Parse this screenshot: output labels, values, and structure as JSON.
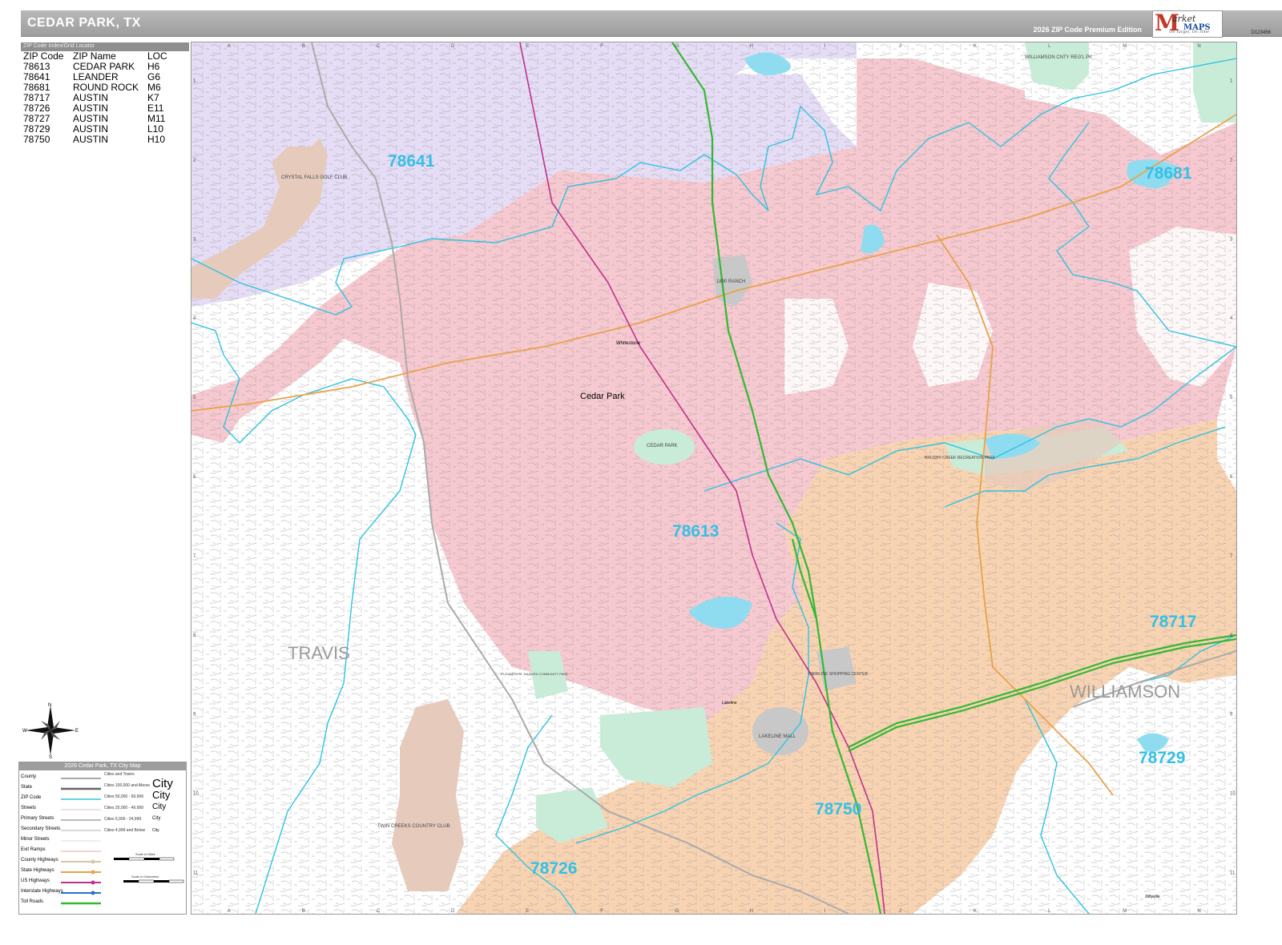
{
  "header": {
    "title": "CEDAR PARK, TX",
    "edition": "2026 ZIP Code Premium Edition",
    "logo": {
      "brand_top": "arket",
      "brand_bottom": "MAPS",
      "tagline": "On Target, On Time"
    },
    "sku": "D123456"
  },
  "zip_index": {
    "heading": "ZIP Code Index/Grid Locator",
    "columns": [
      "ZIP Code",
      "ZIP Name",
      "LOC"
    ],
    "rows": [
      [
        "78613",
        "CEDAR PARK",
        "H6"
      ],
      [
        "78641",
        "LEANDER",
        "G6"
      ],
      [
        "78681",
        "ROUND ROCK",
        "M6"
      ],
      [
        "78717",
        "AUSTIN",
        "K7"
      ],
      [
        "78726",
        "AUSTIN",
        "E11"
      ],
      [
        "78727",
        "AUSTIN",
        "M11"
      ],
      [
        "78729",
        "AUSTIN",
        "L10"
      ],
      [
        "78750",
        "AUSTIN",
        "H10"
      ]
    ]
  },
  "map": {
    "colors": {
      "cedar_park": "#f6c8cf",
      "leander": "#e5dcf5",
      "austin": "#f8d3b2",
      "park": "#c9ecd9",
      "golf": "#e6cbbd",
      "water": "#8fdcf0",
      "zip_boundary": "#2ec3e0",
      "interstate": "#33b833",
      "us_highway": "#c0308c",
      "state_highway": "#e8a24a"
    },
    "column_letters": [
      "A",
      "B",
      "C",
      "D",
      "E",
      "F",
      "G",
      "H",
      "I",
      "J",
      "K",
      "L",
      "M",
      "N"
    ],
    "row_numbers": [
      "1",
      "2",
      "3",
      "4",
      "5",
      "6",
      "7",
      "8",
      "9",
      "10",
      "11"
    ],
    "zip_labels": [
      "78641",
      "78681",
      "78613",
      "78717",
      "78729",
      "78750",
      "78726"
    ],
    "county_labels": [
      "TRAVIS",
      "WILLIAMSON"
    ],
    "city_label": "Cedar Park",
    "place_labels": [
      "CRYSTAL FALLS GOLF CLUB",
      "1890 RANCH",
      "CEDAR PARK",
      "WILLIAMSON CNTY REG'L PK",
      "BRUSHY CREEK RECREATION PARK",
      "PARKLINE SHOPPING CENTER",
      "LAKELINE MALL",
      "TWIN CREEKS COUNTRY CLUB",
      "ELIZABETH M. MILBURN COMMUNITY PARK"
    ],
    "small_labels": [
      "Whitestone",
      "Lakeline",
      "Jollyville"
    ]
  },
  "compass": {
    "n": "N",
    "s": "S",
    "e": "E",
    "w": "W"
  },
  "legend": {
    "title": "2026 Cedar Park, TX City Map",
    "items": [
      "County",
      "State",
      "ZIP Code",
      "Streets",
      "Primary Streets",
      "Secondary Streets",
      "Minor Streets",
      "Exit Ramps",
      "County Highways",
      "State Highways",
      "US Highways",
      "Interstate Highways",
      "Toll Roads"
    ],
    "cities_heading": "Cities and Towns",
    "city_classes": [
      "Cities 100,000 and Above",
      "Cities 50,000 - 99,999",
      "Cities 25,000 - 49,999",
      "Cities 5,000 - 24,999",
      "Cities 4,999 and Below"
    ],
    "city_sample": "City",
    "scale_miles": "Scale in Miles",
    "scale_km": "Scale in Kilometers"
  }
}
